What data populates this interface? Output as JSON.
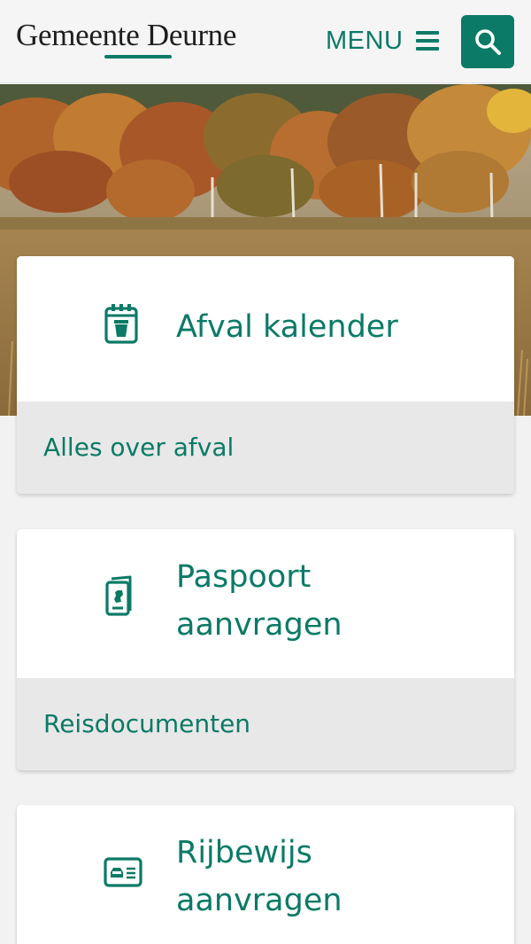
{
  "header": {
    "logo_text": "Gemeente Deurne",
    "menu_label": "MENU",
    "menu_icon": "hamburger-icon",
    "search_icon": "search-icon"
  },
  "colors": {
    "brand_green": "#0b7a66",
    "header_bg": "#f5f5f5",
    "card_link_bg": "#e8e8e8",
    "page_bg": "#f2f2f2"
  },
  "hero": {
    "image": "autumn-forest-heath-photo"
  },
  "tiles": [
    {
      "icon": "waste-bin-calendar-icon",
      "title_lines": [
        "Afval kalender"
      ],
      "link_label": "Alles over afval"
    },
    {
      "icon": "passport-icon",
      "title_lines": [
        "Paspoort",
        "aanvragen"
      ],
      "link_label": "Reisdocumenten"
    },
    {
      "icon": "drivers-license-icon",
      "title_lines": [
        "Rijbewijs",
        "aanvragen"
      ]
    }
  ]
}
